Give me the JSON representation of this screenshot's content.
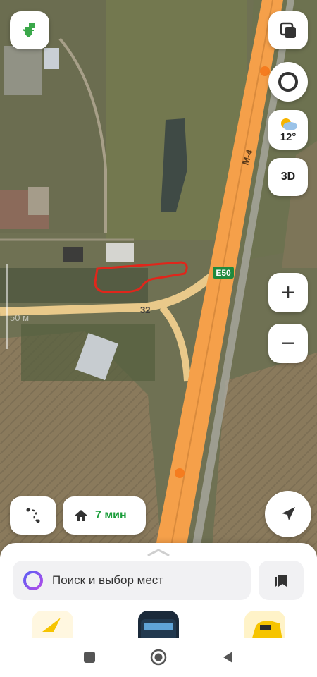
{
  "map": {
    "road_shield_e": "E50",
    "road_shield_m": "M-4",
    "road_number": "32",
    "scale_text": "50 м"
  },
  "controls": {
    "weather_temp": "12°",
    "mode_3d": "3D",
    "zoom_in": "+",
    "zoom_out": "−"
  },
  "route": {
    "eta": "7 мин"
  },
  "sheet": {
    "search_placeholder": "Поиск и выбор мест"
  },
  "colors": {
    "highway": "#f5a04a",
    "road_yellow": "#e9c98a",
    "drawn_outline": "#e0261b",
    "eta_green": "#1a9d3a",
    "alice_purple": "#7a4cf0"
  }
}
